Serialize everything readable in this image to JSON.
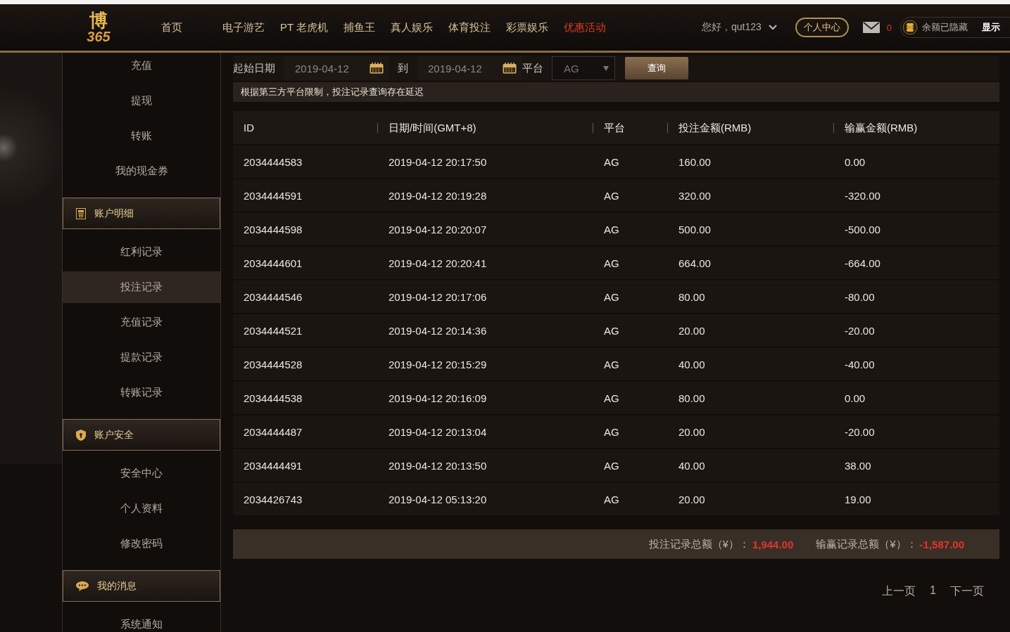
{
  "logo": {
    "main": "博",
    "sub": "365"
  },
  "nav": [
    {
      "label": "首页",
      "promo": false
    },
    {
      "label": "电子游艺",
      "promo": false
    },
    {
      "label": "PT 老虎机",
      "promo": false
    },
    {
      "label": "捕鱼王",
      "promo": false
    },
    {
      "label": "真人娱乐",
      "promo": false
    },
    {
      "label": "体育投注",
      "promo": false
    },
    {
      "label": "彩票娱乐",
      "promo": false
    },
    {
      "label": "优惠活动",
      "promo": true
    }
  ],
  "user": {
    "greeting": "您好，qut123",
    "center_button": "个人中心",
    "messages": "0",
    "balance": "余额已隐藏",
    "show_button": "显示"
  },
  "sidebar": [
    {
      "kind": "items",
      "items": [
        {
          "label": "充值",
          "selected": false
        },
        {
          "label": "提现",
          "selected": false
        },
        {
          "label": "转账",
          "selected": false
        },
        {
          "label": "我的现金券",
          "selected": false
        }
      ]
    },
    {
      "kind": "section",
      "title": "账户明细",
      "items": [
        {
          "label": "红利记录",
          "selected": false
        },
        {
          "label": "投注记录",
          "selected": true
        },
        {
          "label": "充值记录",
          "selected": false
        },
        {
          "label": "提款记录",
          "selected": false
        },
        {
          "label": "转账记录",
          "selected": false
        }
      ]
    },
    {
      "kind": "section",
      "title": "账户安全",
      "items": [
        {
          "label": "安全中心",
          "selected": false
        },
        {
          "label": "个人资料",
          "selected": false
        },
        {
          "label": "修改密码",
          "selected": false
        }
      ]
    },
    {
      "kind": "section",
      "title": "我的消息",
      "items": [
        {
          "label": "系统通知",
          "selected": false
        }
      ]
    }
  ],
  "filter": {
    "start_label": "起始日期",
    "start_date": "2019-04-12",
    "to_label": "到",
    "end_date": "2019-04-12",
    "platform_label": "平台",
    "platform": "AG",
    "query_button": "查询"
  },
  "notice": "根据第三方平台限制，投注记录查询存在延迟",
  "table": {
    "columns": [
      "ID",
      "日期/时间(GMT+8)",
      "平台",
      "投注金额(RMB)",
      "输赢金额(RMB)"
    ],
    "rows": [
      [
        "2034444583",
        "2019-04-12 20:17:50",
        "AG",
        "160.00",
        "0.00"
      ],
      [
        "2034444591",
        "2019-04-12 20:19:28",
        "AG",
        "320.00",
        "-320.00"
      ],
      [
        "2034444598",
        "2019-04-12 20:20:07",
        "AG",
        "500.00",
        "-500.00"
      ],
      [
        "2034444601",
        "2019-04-12 20:20:41",
        "AG",
        "664.00",
        "-664.00"
      ],
      [
        "2034444546",
        "2019-04-12 20:17:06",
        "AG",
        "80.00",
        "-80.00"
      ],
      [
        "2034444521",
        "2019-04-12 20:14:36",
        "AG",
        "20.00",
        "-20.00"
      ],
      [
        "2034444528",
        "2019-04-12 20:15:29",
        "AG",
        "40.00",
        "-40.00"
      ],
      [
        "2034444538",
        "2019-04-12 20:16:09",
        "AG",
        "80.00",
        "0.00"
      ],
      [
        "2034444487",
        "2019-04-12 20:13:04",
        "AG",
        "20.00",
        "-20.00"
      ],
      [
        "2034444491",
        "2019-04-12 20:13:50",
        "AG",
        "40.00",
        "38.00"
      ],
      [
        "2034426743",
        "2019-04-12 05:13:20",
        "AG",
        "20.00",
        "19.00"
      ]
    ]
  },
  "totals": [
    {
      "label": "投注记录总额（¥）：",
      "value": "1,944.00"
    },
    {
      "label": "输赢记录总额（¥）：",
      "value": "-1,587.00"
    }
  ],
  "pagination": {
    "prev": "上一页",
    "page": "1",
    "next": "下一页"
  }
}
